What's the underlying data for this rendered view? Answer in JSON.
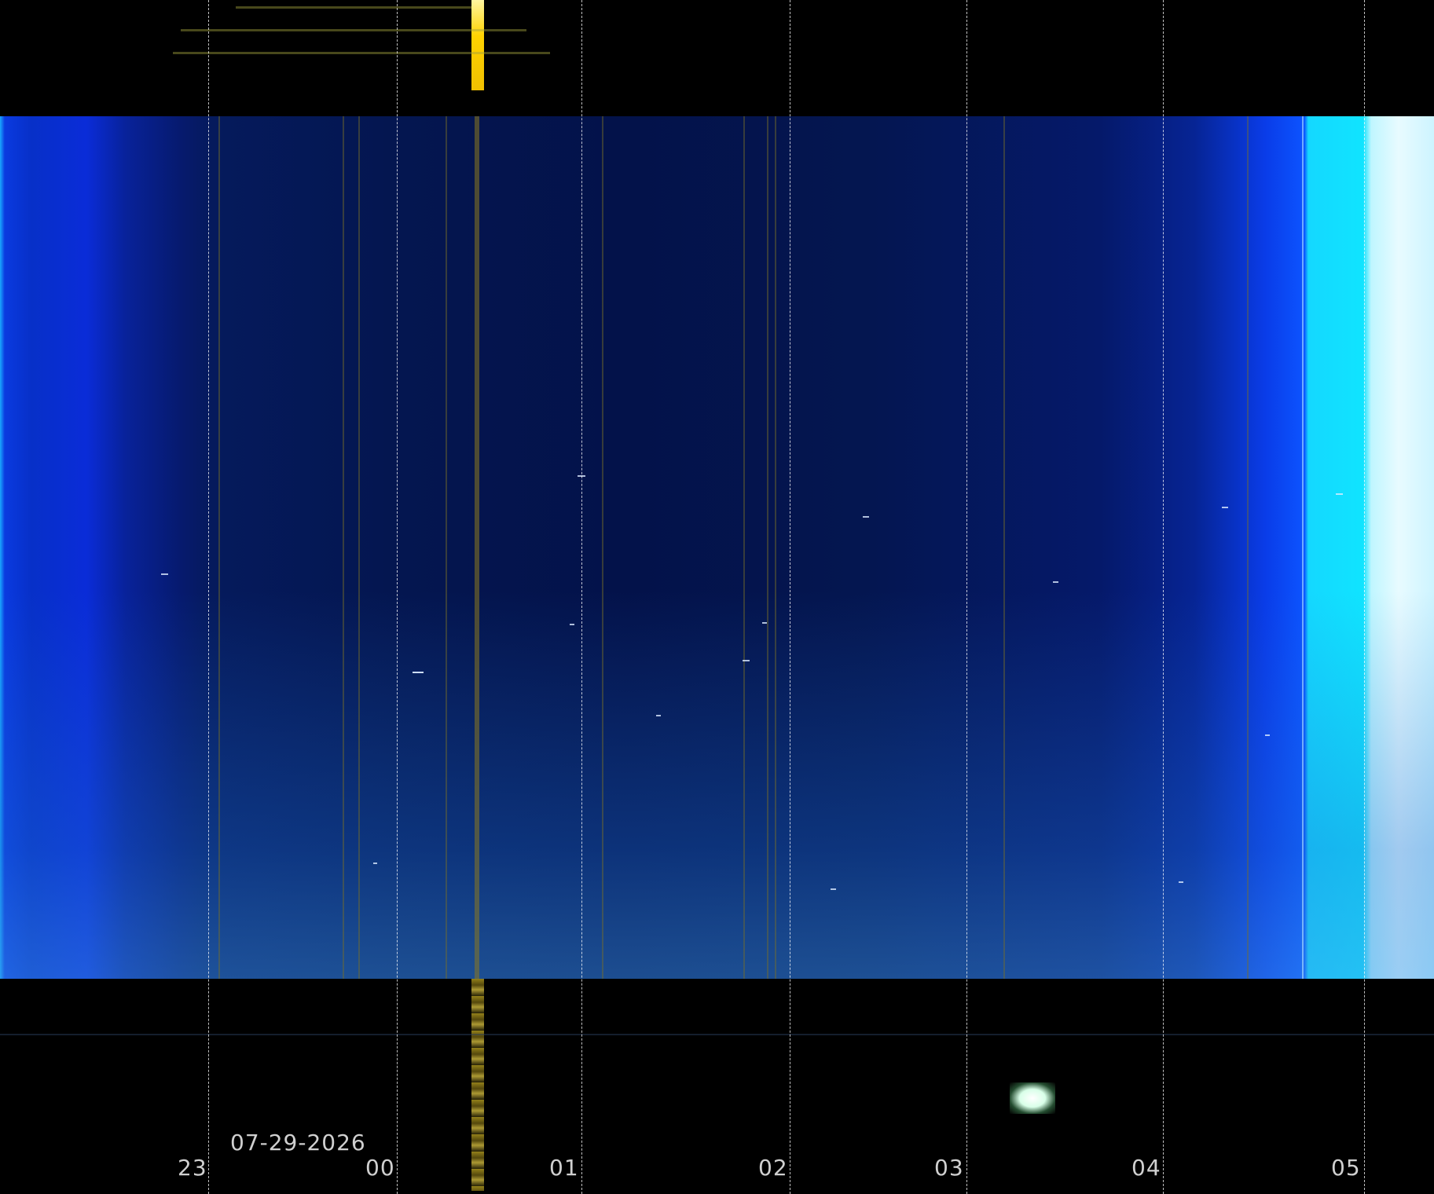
{
  "date": "07-29-2026",
  "hour_labels": [
    "23",
    "00",
    "01",
    "02",
    "03",
    "04",
    "05"
  ]
}
